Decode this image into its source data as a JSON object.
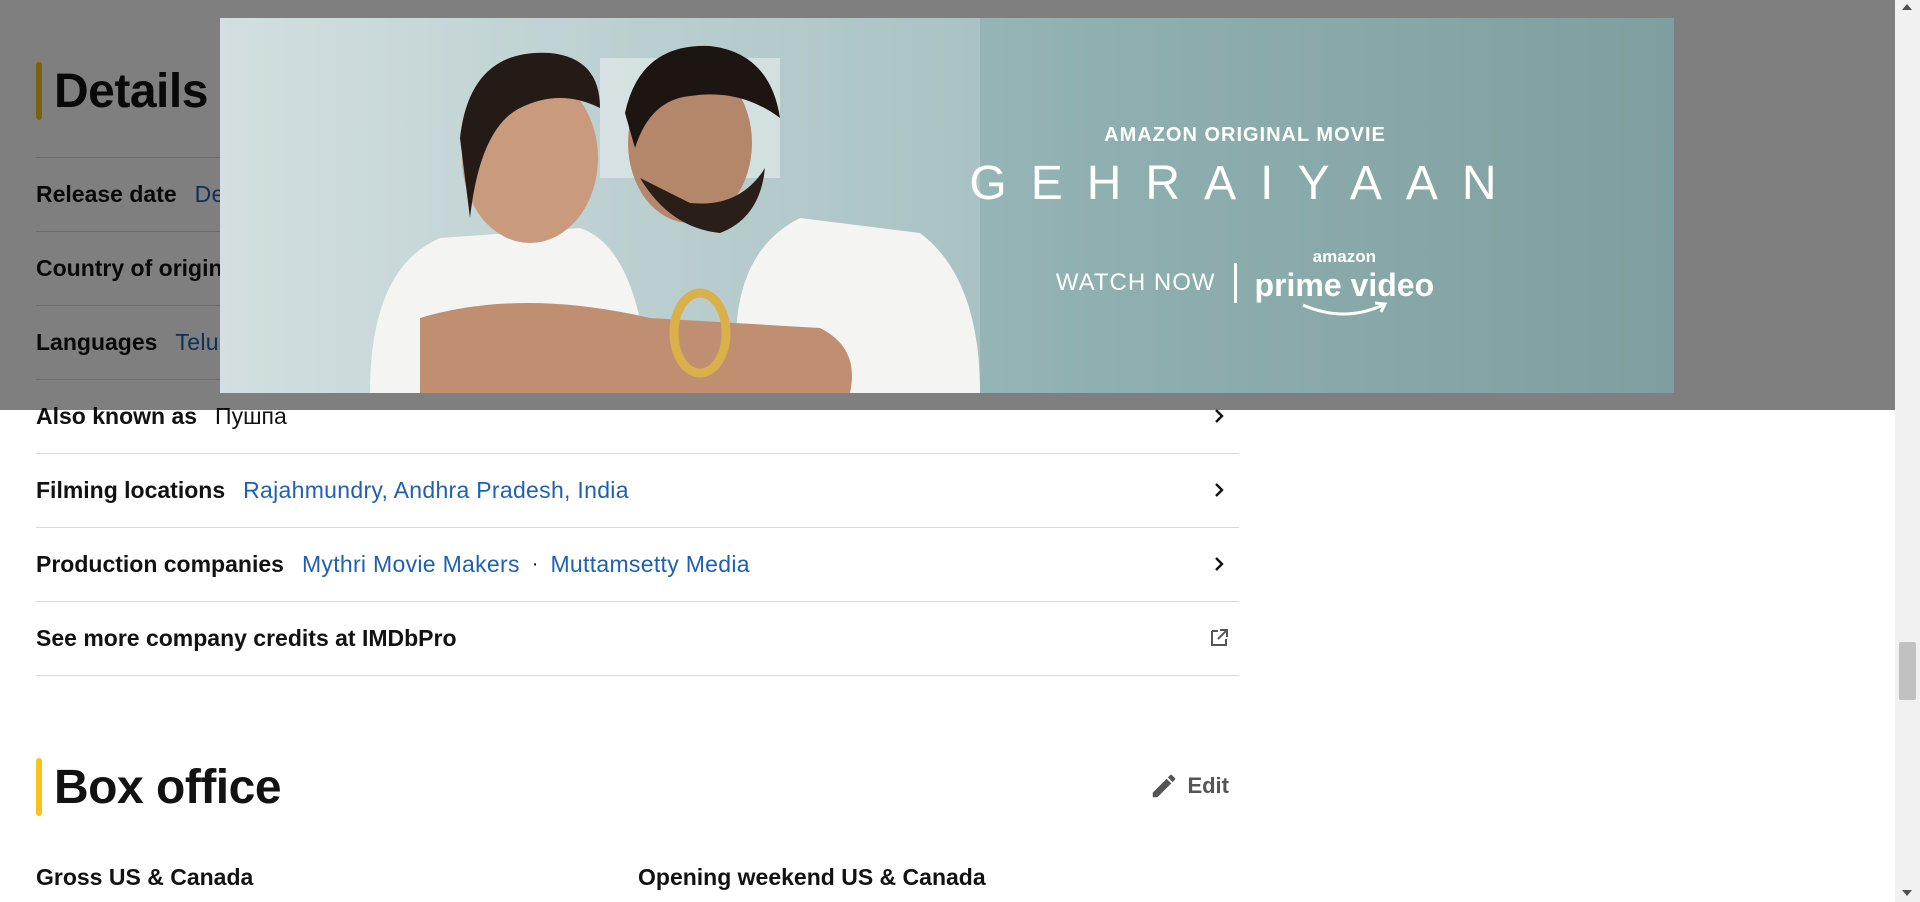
{
  "details": {
    "title": "Details",
    "rows": [
      {
        "label": "Release date",
        "value": "De"
      },
      {
        "label": "Country of origin",
        "value": ""
      },
      {
        "label": "Languages",
        "value": "Telu"
      },
      {
        "label": "Also known as",
        "value": "Пушпа"
      },
      {
        "label": "Filming locations",
        "value": "Rajahmundry, Andhra Pradesh, India"
      },
      {
        "label": "Production companies",
        "companies": [
          "Mythri Movie Makers",
          "Muttamsetty Media"
        ],
        "separator": "·"
      },
      {
        "label": "See more company credits at IMDbPro"
      }
    ]
  },
  "box_office": {
    "title": "Box office",
    "edit_label": "Edit",
    "stats": [
      "Gross US & Canada",
      "Opening weekend US & Canada"
    ]
  },
  "ad": {
    "kicker": "AMAZON ORIGINAL MOVIE",
    "title": "GEHRAIYAAN",
    "cta": "WATCH NOW",
    "brand_small": "amazon",
    "brand_big": "prime video"
  },
  "icons": {
    "row_arrow": "chevron-right-icon",
    "external": "external-link-icon",
    "edit": "pencil-icon"
  },
  "colors": {
    "accent": "#f5c518",
    "link": "#1f5fb4",
    "overlay": "rgba(0,0,0,0.5)"
  }
}
